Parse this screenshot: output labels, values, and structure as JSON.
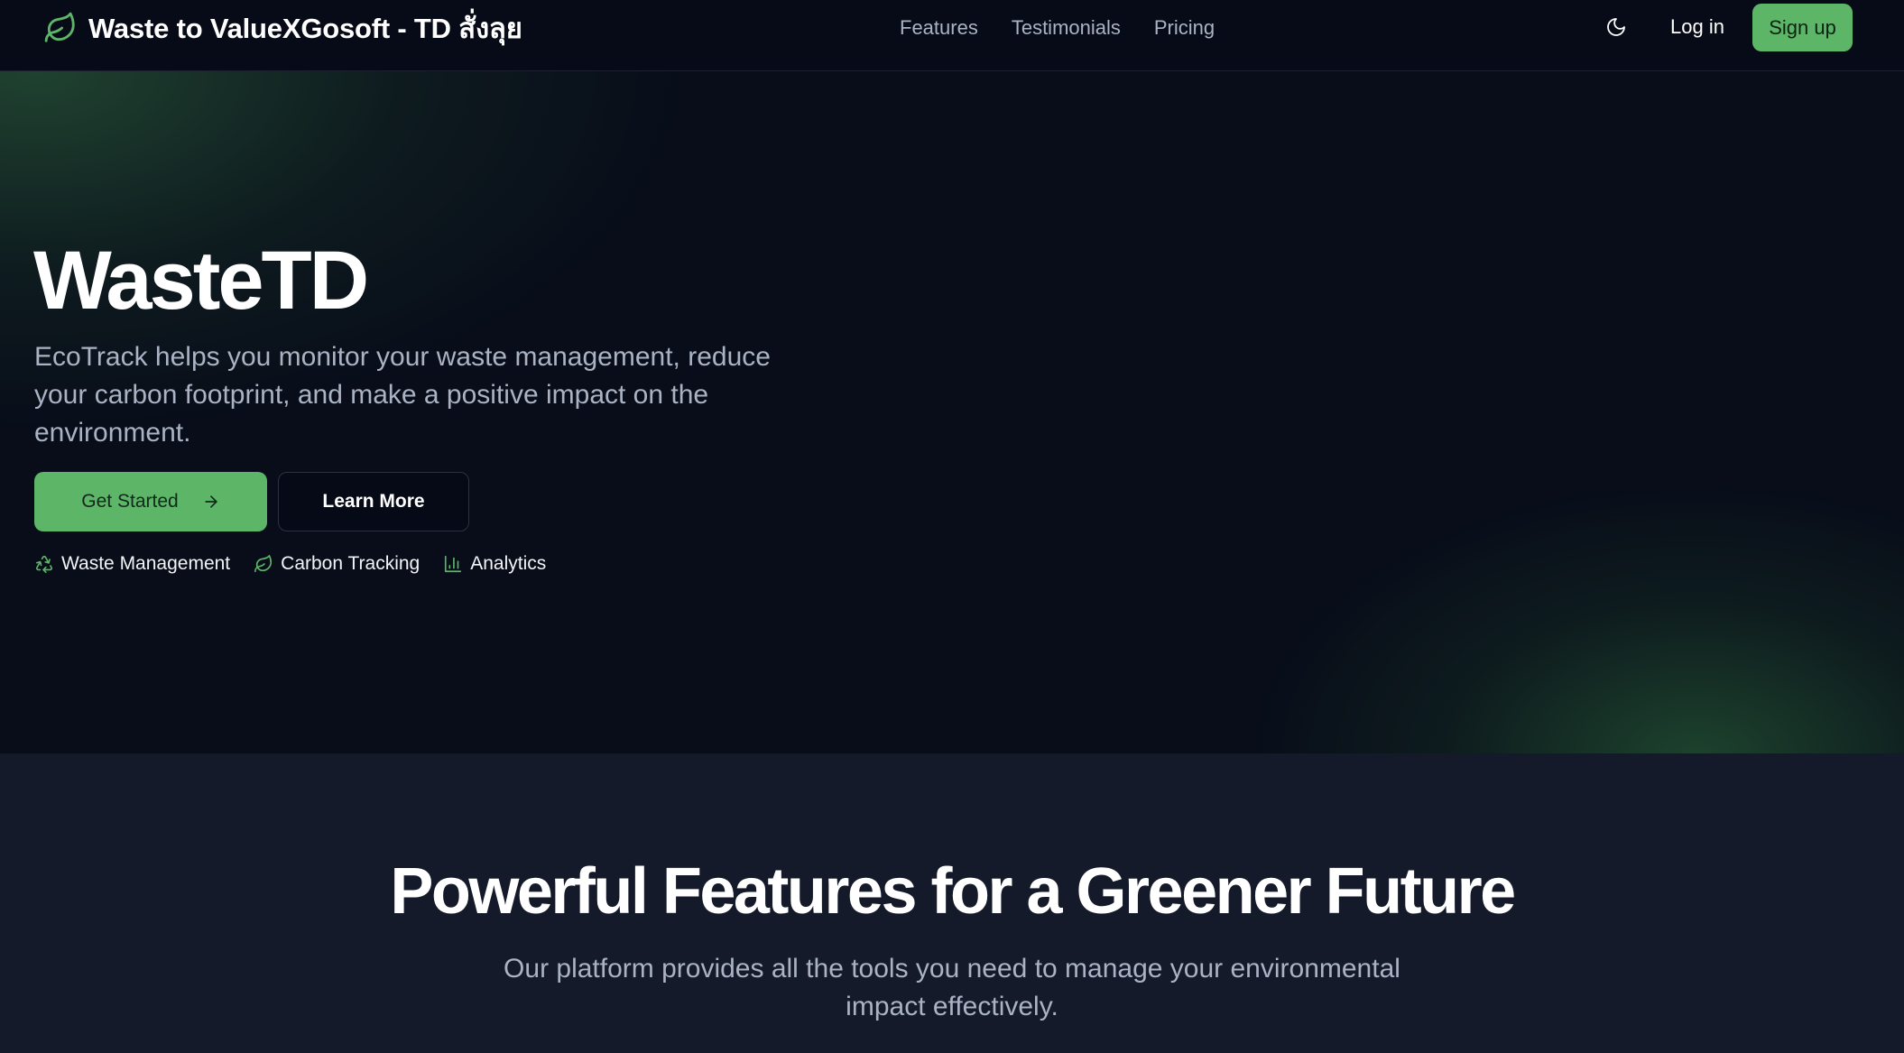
{
  "header": {
    "brand": {
      "icon": "leaf-icon",
      "name": "Waste to ValueXGosoft - TD สั่งลุย"
    },
    "nav": [
      {
        "label": "Features"
      },
      {
        "label": "Testimonials"
      },
      {
        "label": "Pricing"
      }
    ],
    "theme_toggle_icon": "moon-icon",
    "login_label": "Log in",
    "signup_label": "Sign up"
  },
  "hero": {
    "title": "WasteTD",
    "description": "EcoTrack helps you monitor your waste management, reduce your carbon footprint, and make a positive impact on the environment.",
    "primary_button": {
      "label": "Get Started",
      "icon": "arrow-right-icon"
    },
    "secondary_button": {
      "label": "Learn More"
    },
    "tags": [
      {
        "icon": "recycle-icon",
        "label": "Waste Management"
      },
      {
        "icon": "leaf-icon",
        "label": "Carbon Tracking"
      },
      {
        "icon": "bar-chart-icon",
        "label": "Analytics"
      }
    ]
  },
  "features": {
    "title": "Powerful Features for a Greener Future",
    "description": "Our platform provides all the tools you need to manage your environmental impact effectively."
  },
  "colors": {
    "accent": "#5db568",
    "header_bg": "#070b17",
    "hero_bg": "#080d19",
    "section_bg": "#141a2a",
    "muted_text": "#a9b3c4"
  }
}
